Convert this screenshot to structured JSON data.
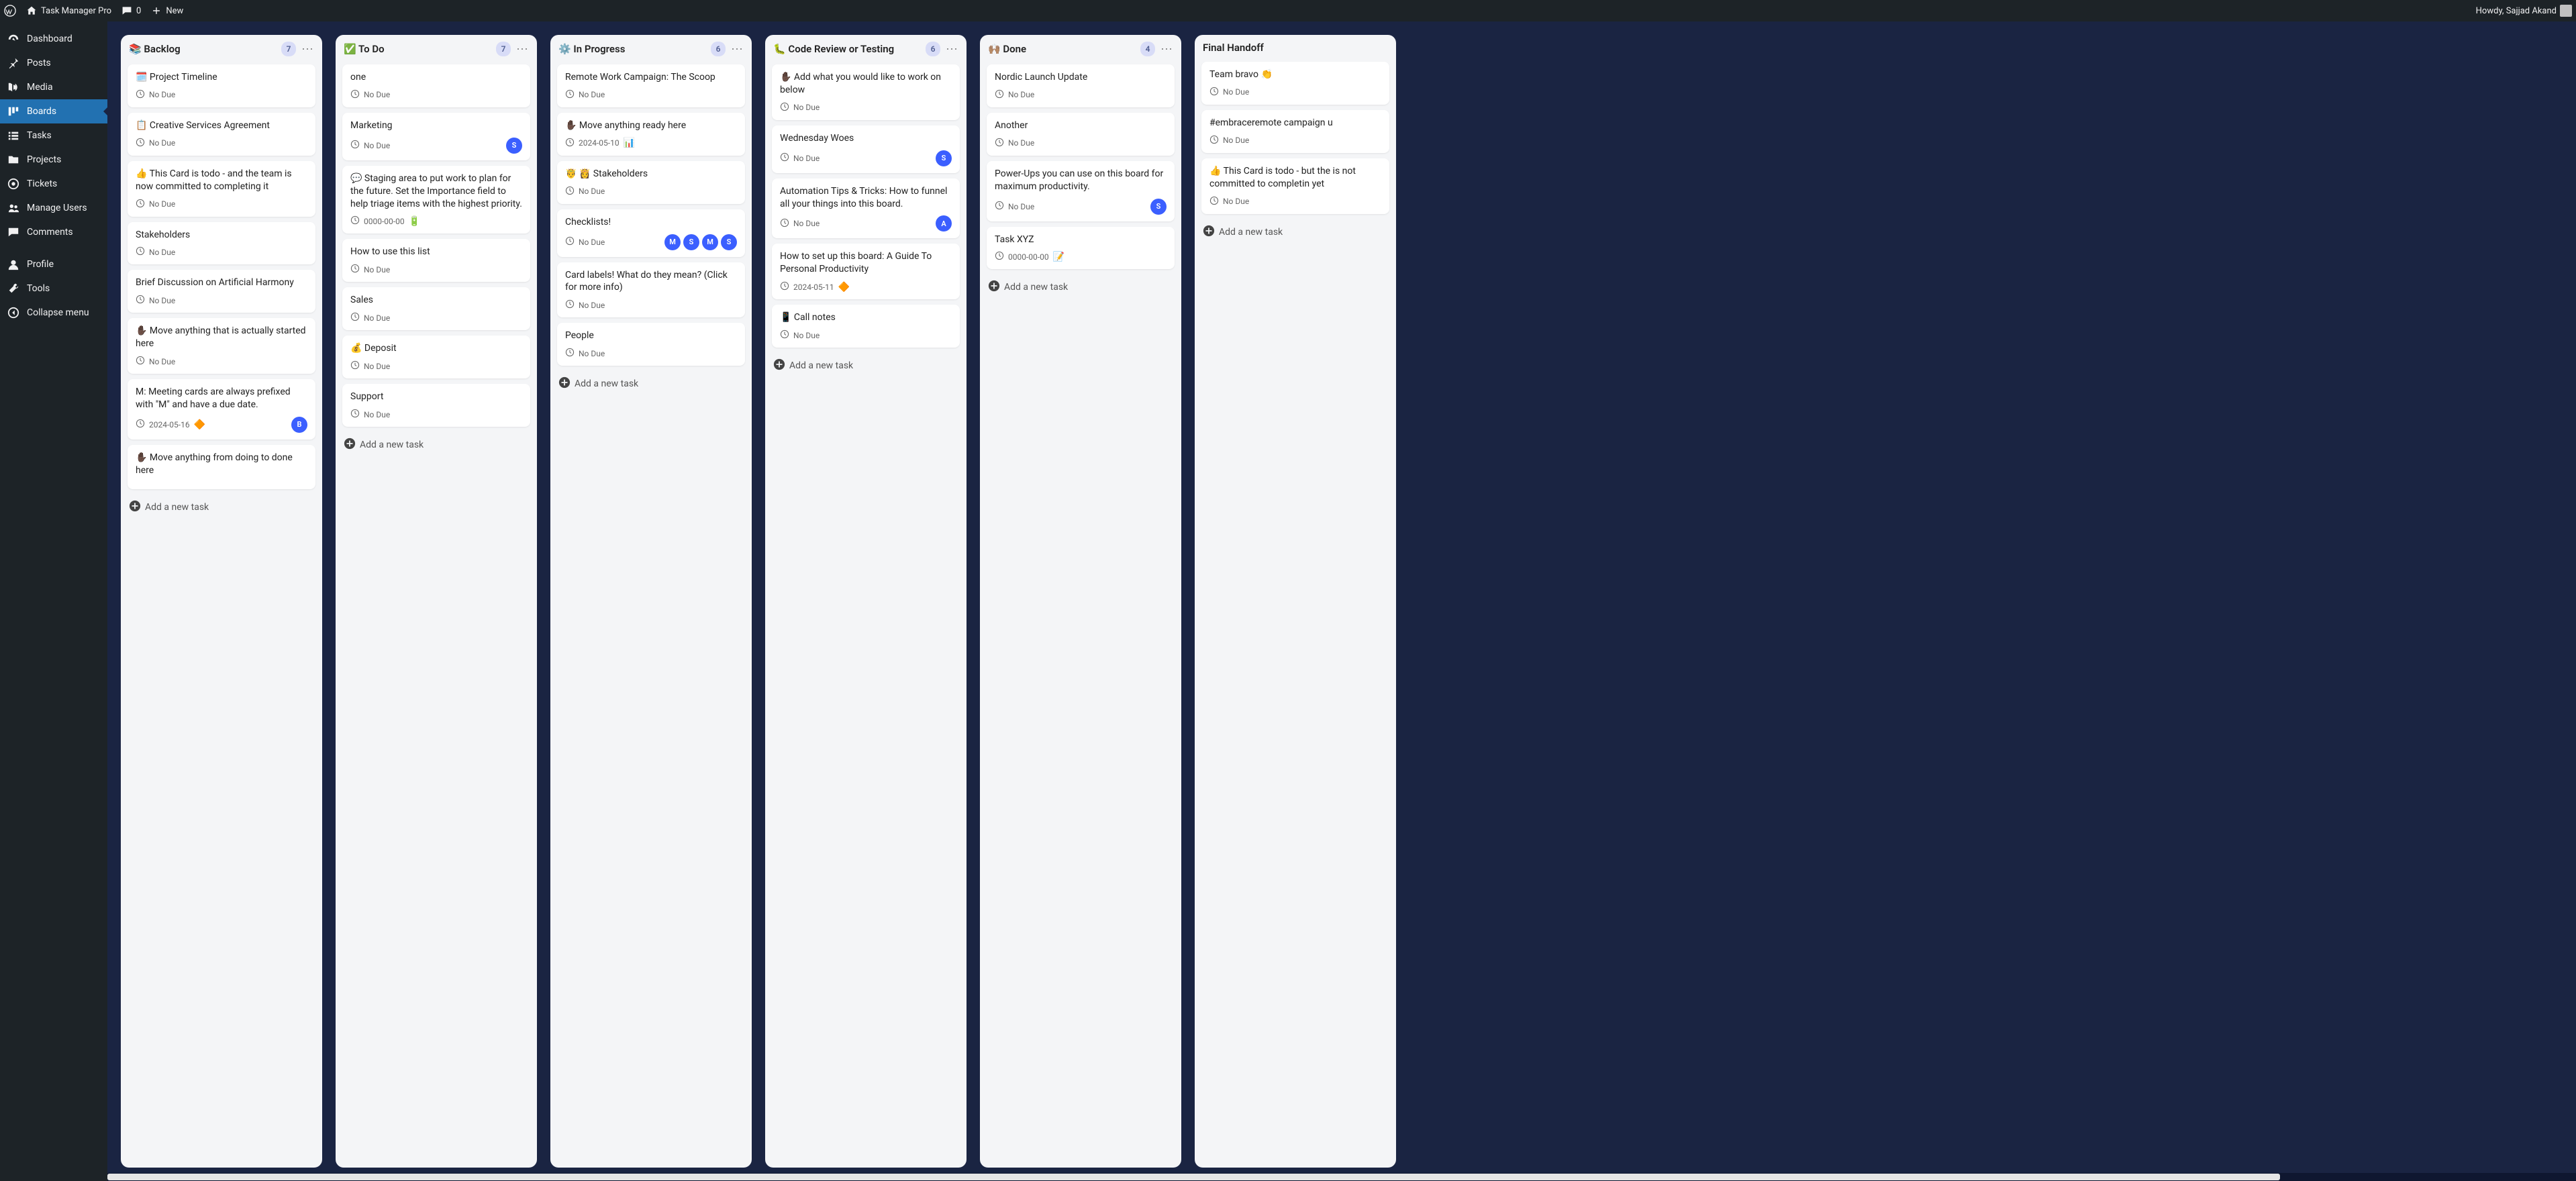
{
  "adminbar": {
    "site_title": "Task Manager Pro",
    "comments_count": "0",
    "new_label": "New",
    "howdy": "Howdy, Sajjad Akand"
  },
  "sidebar": {
    "items": [
      {
        "icon": "gauge",
        "label": "Dashboard",
        "active": false
      },
      {
        "icon": "pin",
        "label": "Posts",
        "active": false
      },
      {
        "icon": "media",
        "label": "Media",
        "active": false
      },
      {
        "icon": "kanban",
        "label": "Boards",
        "active": true
      },
      {
        "icon": "list",
        "label": "Tasks",
        "active": false
      },
      {
        "icon": "folder",
        "label": "Projects",
        "active": false
      },
      {
        "icon": "ticket",
        "label": "Tickets",
        "active": false
      },
      {
        "icon": "users",
        "label": "Manage Users",
        "active": false
      },
      {
        "icon": "comment",
        "label": "Comments",
        "active": false
      },
      {
        "icon": "profile",
        "label": "Profile",
        "active": false
      },
      {
        "icon": "tools",
        "label": "Tools",
        "active": false
      },
      {
        "icon": "collapse",
        "label": "Collapse menu",
        "active": false
      }
    ]
  },
  "add_task_label": "Add a new task",
  "columns": [
    {
      "title": "📚 Backlog",
      "count": "7",
      "cards": [
        {
          "title": "🗓️ Project Timeline",
          "due": "No Due",
          "avatars": [],
          "icons": []
        },
        {
          "title": "📋 Creative Services Agreement",
          "due": "No Due",
          "avatars": [],
          "icons": []
        },
        {
          "title": "👍 This Card is todo - and the team is now committed to completing it",
          "due": "No Due",
          "avatars": [],
          "icons": []
        },
        {
          "title": "Stakeholders",
          "due": "No Due",
          "avatars": [],
          "icons": []
        },
        {
          "title": "Brief Discussion on Artificial Harmony",
          "due": "No Due",
          "avatars": [],
          "icons": []
        },
        {
          "title": "✋🏿 Move anything that is actually started here",
          "due": "No Due",
          "avatars": [],
          "icons": []
        },
        {
          "title": "M: Meeting cards are always prefixed with \"M\" and have a due date.",
          "due": "2024-05-16",
          "avatars": [
            "B"
          ],
          "icons": [
            "🔶"
          ]
        },
        {
          "title": "✋🏿 Move anything from doing to done here",
          "due": "",
          "avatars": [],
          "icons": []
        }
      ]
    },
    {
      "title": "✅ To Do",
      "count": "7",
      "cards": [
        {
          "title": "one",
          "due": "No Due",
          "avatars": [],
          "icons": []
        },
        {
          "title": "Marketing",
          "due": "No Due",
          "avatars": [
            "S"
          ],
          "icons": []
        },
        {
          "title": "💬 Staging area to put work to plan for the future. Set the Importance field to help triage items with the highest priority.",
          "due": "0000-00-00",
          "avatars": [],
          "icons": [
            "🔋"
          ]
        },
        {
          "title": "How to use this list",
          "due": "No Due",
          "avatars": [],
          "icons": []
        },
        {
          "title": "Sales",
          "due": "No Due",
          "avatars": [],
          "icons": []
        },
        {
          "title": "💰 Deposit",
          "due": "No Due",
          "avatars": [],
          "icons": []
        },
        {
          "title": "Support",
          "due": "No Due",
          "avatars": [],
          "icons": []
        }
      ]
    },
    {
      "title": "⚙️ In Progress",
      "count": "6",
      "cards": [
        {
          "title": "Remote Work Campaign: The Scoop",
          "due": "No Due",
          "avatars": [],
          "icons": []
        },
        {
          "title": "✋🏿 Move anything ready here",
          "due": "2024-05-10",
          "avatars": [],
          "icons": [
            "📊"
          ]
        },
        {
          "title": "🤴 👸 Stakeholders",
          "due": "No Due",
          "avatars": [],
          "icons": []
        },
        {
          "title": "Checklists!",
          "due": "No Due",
          "avatars": [
            "M",
            "S",
            "M",
            "S"
          ],
          "icons": []
        },
        {
          "title": "Card labels! What do they mean? (Click for more info)",
          "due": "No Due",
          "avatars": [],
          "icons": []
        },
        {
          "title": "People",
          "due": "No Due",
          "avatars": [],
          "icons": []
        }
      ]
    },
    {
      "title": "🐛 Code Review or Testing",
      "count": "6",
      "cards": [
        {
          "title": "✋🏿 Add what you would like to work on below",
          "due": "No Due",
          "avatars": [],
          "icons": []
        },
        {
          "title": "Wednesday Woes",
          "due": "No Due",
          "avatars": [
            "S"
          ],
          "icons": []
        },
        {
          "title": "Automation Tips & Tricks: How to funnel all your things into this board.",
          "due": "No Due",
          "avatars": [
            "A"
          ],
          "icons": []
        },
        {
          "title": "How to set up this board: A Guide To Personal Productivity",
          "due": "2024-05-11",
          "avatars": [],
          "icons": [
            "🔶"
          ]
        },
        {
          "title": "📱 Call notes",
          "due": "No Due",
          "avatars": [],
          "icons": []
        }
      ]
    },
    {
      "title": "🙌🏽 Done",
      "count": "4",
      "cards": [
        {
          "title": "Nordic Launch Update",
          "due": "No Due",
          "avatars": [],
          "icons": []
        },
        {
          "title": "Another",
          "due": "No Due",
          "avatars": [],
          "icons": []
        },
        {
          "title": "Power-Ups you can use on this board for maximum productivity.",
          "due": "No Due",
          "avatars": [
            "S"
          ],
          "icons": []
        },
        {
          "title": "Task XYZ",
          "due": "0000-00-00",
          "avatars": [],
          "icons": [
            "📝"
          ]
        }
      ]
    },
    {
      "title": "Final Handoff",
      "count": "",
      "cards": [
        {
          "title": "Team bravo 👏",
          "due": "No Due",
          "avatars": [],
          "icons": []
        },
        {
          "title": "#embraceremote campaign u",
          "due": "No Due",
          "avatars": [],
          "icons": []
        },
        {
          "title": "👍 This Card is todo - but the is not committed to completin yet",
          "due": "No Due",
          "avatars": [],
          "icons": []
        }
      ]
    }
  ]
}
